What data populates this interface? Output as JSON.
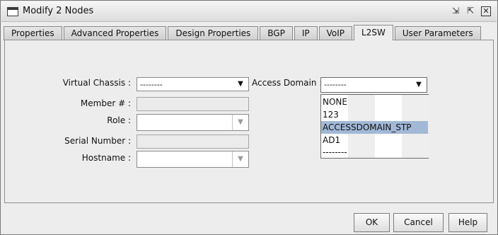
{
  "window": {
    "title": "Modify 2 Nodes"
  },
  "tabs": [
    {
      "label": "Properties",
      "active": false
    },
    {
      "label": "Advanced Properties",
      "active": false
    },
    {
      "label": "Design Properties",
      "active": false
    },
    {
      "label": "BGP",
      "active": false
    },
    {
      "label": "IP",
      "active": false
    },
    {
      "label": "VoIP",
      "active": false
    },
    {
      "label": "L2SW",
      "active": true
    },
    {
      "label": "User Parameters",
      "active": false
    }
  ],
  "form": {
    "virtual_chassis": {
      "label": "Virtual Chassis :",
      "value": "--------"
    },
    "member": {
      "label": "Member # :",
      "value": ""
    },
    "role": {
      "label": "Role :",
      "value": ""
    },
    "serial_number": {
      "label": "Serial Number :",
      "value": ""
    },
    "hostname": {
      "label": "Hostname :",
      "value": ""
    },
    "access_domain": {
      "label": "Access Domain :",
      "value": "--------",
      "options": [
        "NONE",
        "123",
        "ACCESSDOMAIN_STP",
        "AD1",
        "--------"
      ],
      "highlighted": "ACCESSDOMAIN_STP"
    }
  },
  "buttons": {
    "ok": "OK",
    "cancel": "Cancel",
    "help": "Help"
  },
  "icons": {
    "minimize": "minimize-icon",
    "maximize": "maximize-icon",
    "close": "close-icon",
    "dropdown": "chevron-down-icon"
  },
  "colors": {
    "selection": "#a2b8d6",
    "background": "#ededed"
  }
}
